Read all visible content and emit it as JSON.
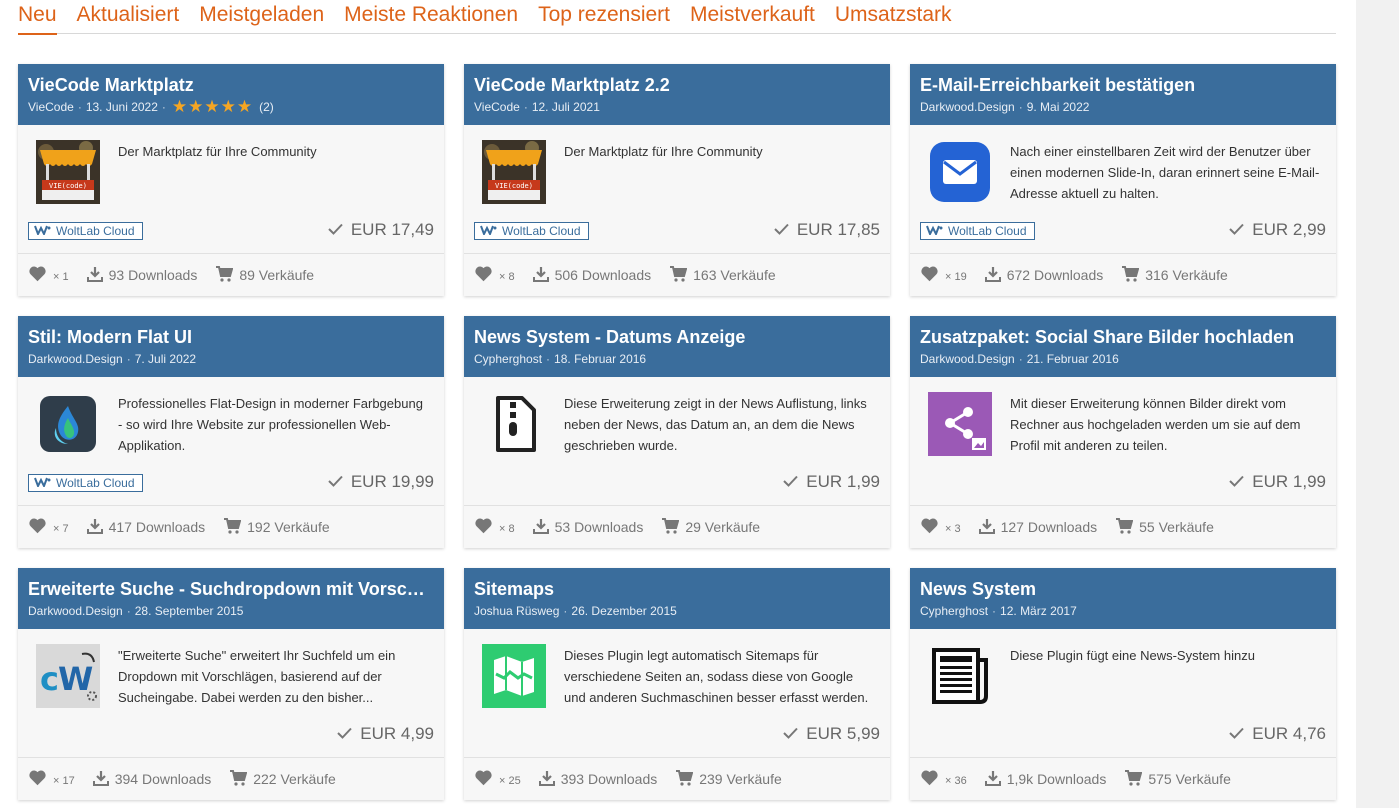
{
  "tabs": [
    {
      "label": "Neu",
      "active": true
    },
    {
      "label": "Aktualisiert"
    },
    {
      "label": "Meistgeladen"
    },
    {
      "label": "Meiste Reaktionen"
    },
    {
      "label": "Top rezensiert"
    },
    {
      "label": "Meistverkauft"
    },
    {
      "label": "Umsatzstark"
    }
  ],
  "colors": {
    "accent": "#dd6319",
    "header": "#3a6d9c",
    "star": "#f5a623"
  },
  "cards": [
    {
      "title": "VieCode Marktplatz",
      "author": "VieCode",
      "date": "13. Juni 2022",
      "rating": {
        "stars": 5,
        "count": "(2)"
      },
      "description": "Der Marktplatz für Ihre Community",
      "thumb": "viecode-market-icon",
      "badge": "WoltLab Cloud",
      "price": "EUR 17,49",
      "likes": "× 1",
      "downloads": "93 Downloads",
      "sales": "89 Verkäufe"
    },
    {
      "title": "VieCode Marktplatz 2.2",
      "author": "VieCode",
      "date": "12. Juli 2021",
      "description": "Der Marktplatz für Ihre Community",
      "thumb": "viecode-market-icon",
      "badge": "WoltLab Cloud",
      "price": "EUR 17,85",
      "likes": "× 8",
      "downloads": "506 Downloads",
      "sales": "163 Verkäufe"
    },
    {
      "title": "E-Mail-Erreichbarkeit bestätigen",
      "author": "Darkwood.Design",
      "date": "9. Mai 2022",
      "description": "Nach einer einstellbaren Zeit wird der Benutzer über einen modernen Slide-In, daran erinnert seine E-Mail-Adresse aktuell zu halten.",
      "thumb": "mail-icon",
      "badge": "WoltLab Cloud",
      "price": "EUR 2,99",
      "likes": "× 19",
      "downloads": "672 Downloads",
      "sales": "316 Verkäufe"
    },
    {
      "title": "Stil: Modern Flat UI",
      "author": "Darkwood.Design",
      "date": "7. Juli 2022",
      "description": "Professionelles Flat-Design in moderner Farbgebung - so wird Ihre Website zur professionellen Web-Applikation.",
      "thumb": "flat-ui-icon",
      "badge": "WoltLab Cloud",
      "price": "EUR 19,99",
      "likes": "× 7",
      "downloads": "417 Downloads",
      "sales": "192 Verkäufe"
    },
    {
      "title": "News System - Datums Anzeige",
      "author": "Cypherghost",
      "date": "18. Februar 2016",
      "description": "Diese Erweiterung zeigt in der News Auflistung, links neben der News, das Datum an, an dem die News geschrieben wurde.",
      "thumb": "file-zip-icon",
      "price": "EUR 1,99",
      "likes": "× 8",
      "downloads": "53 Downloads",
      "sales": "29 Verkäufe"
    },
    {
      "title": "Zusatzpaket: Social Share Bilder hochladen",
      "author": "Darkwood.Design",
      "date": "21. Februar 2016",
      "description": "Mit dieser Erweiterung können Bilder direkt vom Rechner aus hochgeladen werden um sie auf dem Profil mit anderen zu teilen.",
      "thumb": "share-icon",
      "price": "EUR 1,99",
      "likes": "× 3",
      "downloads": "127 Downloads",
      "sales": "55 Verkäufe"
    },
    {
      "title": "Erweiterte Suche - Suchdropdown mit Vorschlägen",
      "author": "Darkwood.Design",
      "date": "28. September 2015",
      "description": "\"Erweiterte Suche\" erweitert Ihr Suchfeld um ein Dropdown mit Vorschlägen, basierend auf der Sucheingabe. Dabei werden zu den bisher...",
      "thumb": "cw-search-icon",
      "price": "EUR 4,99",
      "likes": "× 17",
      "downloads": "394 Downloads",
      "sales": "222 Verkäufe"
    },
    {
      "title": "Sitemaps",
      "author": "Joshua Rüsweg",
      "date": "26. Dezember 2015",
      "description": "Dieses Plugin legt automatisch Sitemaps für verschiedene Seiten an, sodass diese von Google und anderen Suchmaschinen besser erfasst werden.",
      "thumb": "map-icon",
      "price": "EUR 5,99",
      "likes": "× 25",
      "downloads": "393 Downloads",
      "sales": "239 Verkäufe"
    },
    {
      "title": "News System",
      "author": "Cypherghost",
      "date": "12. März 2017",
      "description": "Diese Plugin fügt eine News-System hinzu",
      "thumb": "newspaper-icon",
      "price": "EUR 4,76",
      "likes": "× 36",
      "downloads": "1,9k Downloads",
      "sales": "575 Verkäufe"
    }
  ]
}
